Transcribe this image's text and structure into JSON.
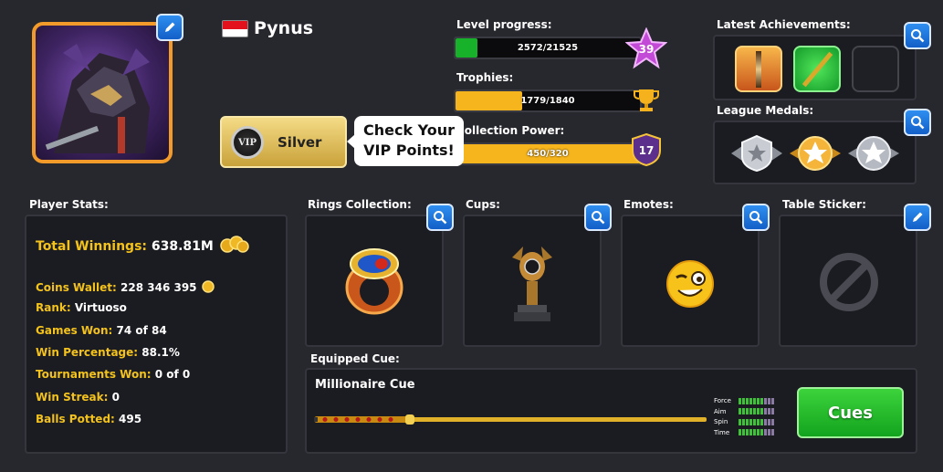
{
  "player": {
    "name": "Pynus",
    "flag_colors": [
      "#e3111c",
      "#ffffff"
    ]
  },
  "vip": {
    "badge": "VIP",
    "tier": "Silver",
    "callout": "Check Your VIP Points!"
  },
  "level_progress": {
    "label": "Level progress:",
    "value": "2572/21525",
    "fraction": 0.12,
    "level": "39",
    "fill_color": "#18b22a"
  },
  "trophies": {
    "label": "Trophies:",
    "value": "1779/1840",
    "fraction": 0.36,
    "fill_color": "#f7b51d"
  },
  "collection_power": {
    "label": "Collection Power:",
    "value": "450/320",
    "fraction": 1.0,
    "rank": "17",
    "fill_color": "#f7b51d"
  },
  "achievements": {
    "label": "Latest Achievements:",
    "items": [
      "cue-achievement-icon",
      "chain-cue-achievement-icon",
      "empty-slot"
    ]
  },
  "league_medals": {
    "label": "League Medals:",
    "items": [
      "silver-medal-icon",
      "gold-medal-icon",
      "silver-star-medal-icon"
    ]
  },
  "player_stats": {
    "label": "Player Stats:",
    "total_winnings_key": "Total Winnings:",
    "total_winnings_val": "638.81M",
    "rows": [
      {
        "k": "Coins Wallet:",
        "v": "228 346 395"
      },
      {
        "k": "Rank:",
        "v": "Virtuoso"
      },
      {
        "k": "Games Won:",
        "v": "74 of 84"
      },
      {
        "k": "Win Percentage:",
        "v": "88.1%"
      },
      {
        "k": "Tournaments Won:",
        "v": "0 of 0"
      },
      {
        "k": "Win Streak:",
        "v": "0"
      },
      {
        "k": "Balls Potted:",
        "v": "495"
      }
    ]
  },
  "collections": {
    "rings": "Rings Collection:",
    "cups": "Cups:",
    "emotes": "Emotes:",
    "table_sticker": "Table Sticker:"
  },
  "equipped_cue": {
    "label": "Equipped Cue:",
    "name": "Millionaire Cue",
    "stats": [
      {
        "name": "Force",
        "level": 7,
        "max": 10
      },
      {
        "name": "Aim",
        "level": 7,
        "max": 10
      },
      {
        "name": "Spin",
        "level": 7,
        "max": 10
      },
      {
        "name": "Time",
        "level": 7,
        "max": 10
      }
    ],
    "button": "Cues"
  }
}
